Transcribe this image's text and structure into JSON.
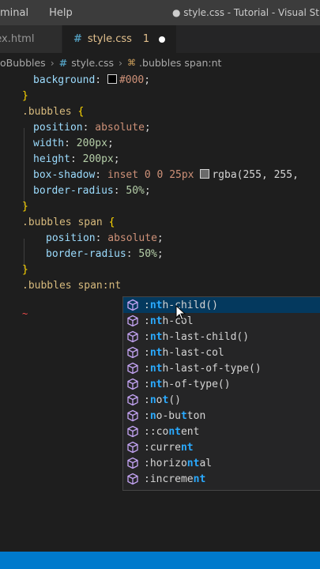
{
  "menubar": {
    "items": [
      "minal",
      "Help"
    ],
    "title": "● style.css - Tutorial - Visual Studi"
  },
  "tabs": [
    {
      "label": "dex.html",
      "active": false
    },
    {
      "label": "style.css",
      "active": true,
      "count": "1"
    }
  ],
  "breadcrumb": {
    "folder": "oBubbles",
    "file": "style.css",
    "symbol": ".bubbles span:nt"
  },
  "code": {
    "l1": {
      "prop": "background",
      "val": "#000"
    },
    "l3": {
      "sel": ".bubbles"
    },
    "l4": {
      "prop": "position",
      "val": "absolute"
    },
    "l5": {
      "prop": "width",
      "val": "200px"
    },
    "l6": {
      "prop": "height",
      "val": "200px"
    },
    "l7": {
      "prop": "box-shadow",
      "val": "inset 0 0 25px",
      "fn": "rgba(255, 255, "
    },
    "l8": {
      "prop": "border-radius",
      "val": "50%"
    },
    "l10": {
      "sel": ".bubbles span"
    },
    "l11": {
      "prop": "position",
      "val": "absolute"
    },
    "l12": {
      "prop": "border-radius",
      "val": "50%"
    },
    "l14": {
      "sel": ".bubbles span:nt"
    }
  },
  "suggestions": [
    {
      "pre": ":",
      "hl": "nt",
      "post": "h-child()"
    },
    {
      "pre": ":",
      "hl": "nt",
      "post": "h-col"
    },
    {
      "pre": ":",
      "hl": "nt",
      "post": "h-last-child()"
    },
    {
      "pre": ":",
      "hl": "nt",
      "post": "h-last-col"
    },
    {
      "pre": ":",
      "hl": "nt",
      "post": "h-last-of-type()"
    },
    {
      "pre": ":",
      "hl": "nt",
      "post": "h-of-type()"
    },
    {
      "pre": ":",
      "hl": "n",
      "post": "o",
      "hl2": "t",
      "post2": "()"
    },
    {
      "pre": ":",
      "hl": "n",
      "post": "o-bu",
      "hl2": "t",
      "post2": "ton"
    },
    {
      "pre": "::co",
      "hl": "nt",
      "post": "ent"
    },
    {
      "pre": ":curre",
      "hl": "nt",
      "post": ""
    },
    {
      "pre": ":horizo",
      "hl": "nt",
      "post": "al"
    },
    {
      "pre": ":increme",
      "hl": "nt",
      "post": ""
    }
  ],
  "colors": {
    "accent": "#007acc",
    "keyword_selector": "#d7ba7d",
    "property": "#9cdcfe",
    "value": "#ce9178",
    "match": "#2aaaff"
  },
  "icons": {
    "suggestion": "cube-icon",
    "mouse": "pointer-cursor-icon"
  }
}
